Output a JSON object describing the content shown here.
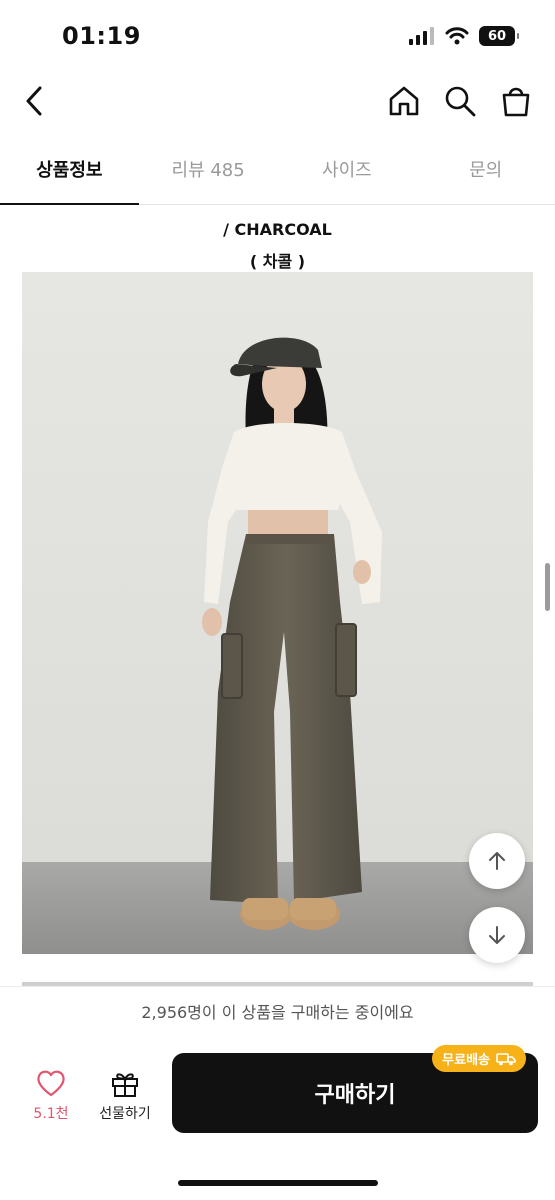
{
  "status_bar": {
    "time": "01:19",
    "battery": "60"
  },
  "tabs": [
    {
      "label": "상품정보"
    },
    {
      "label": "리뷰 485"
    },
    {
      "label": "사이즈"
    },
    {
      "label": "문의"
    }
  ],
  "content": {
    "color_name": "/ CHARCOAL",
    "color_name_kr": "( 차콜 )"
  },
  "banner": {
    "text": "2,956명이 이 상품을 구매하는 중이에요"
  },
  "bottom_bar": {
    "like_count": "5.1천",
    "gift_label": "선물하기",
    "buy_label": "구매하기",
    "free_shipping_badge": "무료배송"
  },
  "colors": {
    "accent_pink": "#e0566e",
    "badge_yellow": "#f7b21a",
    "buy_button": "#111111"
  }
}
